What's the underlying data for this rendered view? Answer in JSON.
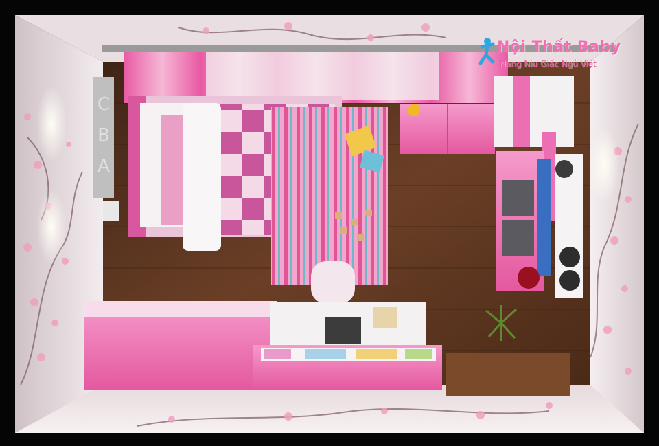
{
  "watermark": {
    "brand": "Nội Thất Baby",
    "tagline": "Nâng Niu Giấc Ngủ Việt",
    "brand_color": "#f06fb0",
    "tagline_color": "#e85aa3",
    "icon": "running-child-icon"
  },
  "wall_letters": [
    "A",
    "B",
    "C"
  ],
  "colors": {
    "pink": "#ec6fb4",
    "light_pink": "#f7c2dc",
    "floor": "#5a3420",
    "wall": "#efe6e8"
  }
}
